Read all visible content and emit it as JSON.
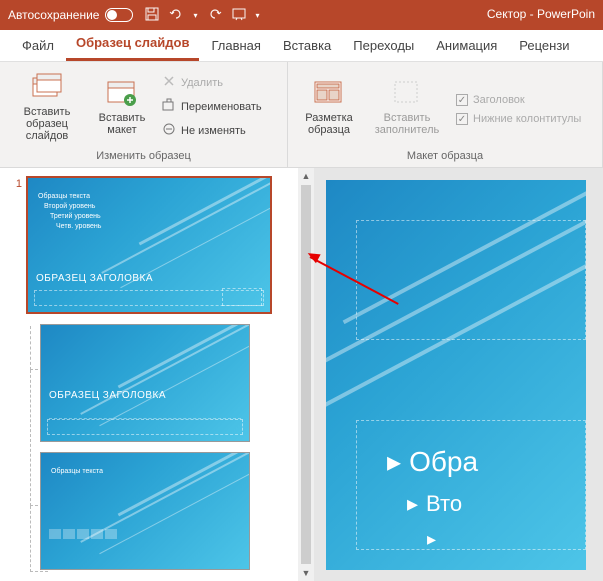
{
  "titlebar": {
    "autosave": "Автосохранение",
    "doc": "Сектор - PowerPoin"
  },
  "tabs": {
    "file": "Файл",
    "master": "Образец слайдов",
    "home": "Главная",
    "insert": "Вставка",
    "transitions": "Переходы",
    "animation": "Анимация",
    "review": "Рецензи"
  },
  "ribbon": {
    "insert_master": "Вставить образец слайдов",
    "insert_layout": "Вставить макет",
    "delete": "Удалить",
    "rename": "Переименовать",
    "preserve": "Не изменять",
    "group1": "Изменить образец",
    "layout": "Разметка образца",
    "insert_ph": "Вставить заполнитель",
    "title_chk": "Заголовок",
    "footers_chk": "Нижние колонтитулы",
    "group2": "Макет образца"
  },
  "slides": {
    "master_num": "1",
    "body_text": "Образцы текста",
    "lvl2": "Второй уровень",
    "lvl3": "Третий уровень",
    "lvl4": "Четв. уровень",
    "title": "ОБРАЗЕЦ ЗАГОЛОВКА",
    "main_title": "Обра",
    "main_sub": "Вто"
  }
}
